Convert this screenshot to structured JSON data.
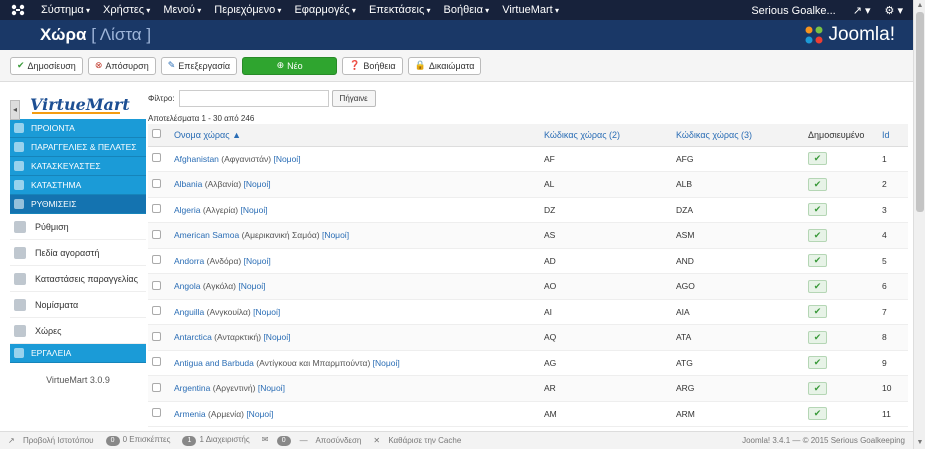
{
  "topnav": {
    "menus": [
      "Σύστημα",
      "Χρήστες",
      "Μενού",
      "Περιεχόμενο",
      "Εφαρμογές",
      "Επεκτάσεις",
      "Βοήθεια",
      "VirtueMart"
    ],
    "user": "Serious Goalke...",
    "user_icon": "external-link-icon",
    "settings_icon": "gear-icon"
  },
  "header": {
    "title": "Χώρα",
    "subtitle": "[ Λίστα ]",
    "brand": "Joomla!"
  },
  "toolbar": {
    "publish": "Δημοσίευση",
    "unpublish": "Απόσυρση",
    "edit": "Επεξεργασία",
    "new": "Νέο",
    "help": "Βοήθεια",
    "permissions": "Δικαιώματα"
  },
  "sidebar": {
    "logo": "VirtueMart",
    "items": [
      {
        "label": "ΠΡΟΙΟΝΤΑ",
        "icon": "products-icon"
      },
      {
        "label": "ΠΑΡΑΓΓΕΛΙΕΣ & ΠΕΛΑΤΕΣ",
        "icon": "orders-icon"
      },
      {
        "label": "ΚΑΤΑΣΚΕΥΑΣΤΕΣ",
        "icon": "wrench-icon"
      },
      {
        "label": "ΚΑΤΑΣΤΗΜΑ",
        "icon": "store-icon"
      },
      {
        "label": "ΡΥΘΜΙΣΕΙΣ",
        "icon": "settings-icon"
      }
    ],
    "subitems": [
      {
        "label": "Ρύθμιση",
        "icon": "config-icon"
      },
      {
        "label": "Πεδία αγοραστή",
        "icon": "fields-icon"
      },
      {
        "label": "Καταστάσεις παραγγελίας",
        "icon": "order-status-icon"
      },
      {
        "label": "Νομίσματα",
        "icon": "currency-icon"
      },
      {
        "label": "Χώρες",
        "icon": "globe-icon"
      }
    ],
    "tools": "ΕΡΓΑΛΕΙΑ",
    "version": "VirtueMart 3.0.9"
  },
  "main": {
    "filter_label": "Φίλτρο:",
    "filter_value": "",
    "go_button": "Πήγαινε",
    "results": "Αποτελέσματα 1 - 30 από 246",
    "columns": [
      "Ονομα χώρας ▲",
      "Κώδικας χώρας (2)",
      "Κώδικας χώρας (3)",
      "Δημοσιευμένο",
      "Id"
    ],
    "rows": [
      {
        "name": "Afghanistan",
        "local": "(Αφγανιστάν)",
        "states": "[Νομοί]",
        "code2": "AF",
        "code3": "AFG",
        "id": "1"
      },
      {
        "name": "Albania",
        "local": "(Αλβανία)",
        "states": "[Νομοί]",
        "code2": "AL",
        "code3": "ALB",
        "id": "2"
      },
      {
        "name": "Algeria",
        "local": "(Αλγερία)",
        "states": "[Νομοί]",
        "code2": "DZ",
        "code3": "DZA",
        "id": "3"
      },
      {
        "name": "American Samoa",
        "local": "(Αμερικανική Σαμόα)",
        "states": "[Νομοί]",
        "code2": "AS",
        "code3": "ASM",
        "id": "4"
      },
      {
        "name": "Andorra",
        "local": "(Ανδόρα)",
        "states": "[Νομοί]",
        "code2": "AD",
        "code3": "AND",
        "id": "5"
      },
      {
        "name": "Angola",
        "local": "(Αγκόλα)",
        "states": "[Νομοί]",
        "code2": "AO",
        "code3": "AGO",
        "id": "6"
      },
      {
        "name": "Anguilla",
        "local": "(Ανγκουίλα)",
        "states": "[Νομοί]",
        "code2": "AI",
        "code3": "AIA",
        "id": "7"
      },
      {
        "name": "Antarctica",
        "local": "(Ανταρκτική)",
        "states": "[Νομοί]",
        "code2": "AQ",
        "code3": "ATA",
        "id": "8"
      },
      {
        "name": "Antigua and Barbuda",
        "local": "(Αντίγκουα και Μπαρμπούντα)",
        "states": "[Νομοί]",
        "code2": "AG",
        "code3": "ATG",
        "id": "9"
      },
      {
        "name": "Argentina",
        "local": "(Αργεντινή)",
        "states": "[Νομοί]",
        "code2": "AR",
        "code3": "ARG",
        "id": "10"
      },
      {
        "name": "Armenia",
        "local": "(Αρμενία)",
        "states": "[Νομοί]",
        "code2": "AM",
        "code3": "ARM",
        "id": "11"
      }
    ]
  },
  "footer": {
    "view_site": "Προβολή Ιστοτόπου",
    "visitors_count": "0",
    "visitors": "0 Επισκέπτες",
    "admins_count": "1",
    "admins": "1 Διαχειριστής",
    "messages_count": "0",
    "logout": "Αποσύνδεση",
    "clear_cache": "Καθάρισε την Cache",
    "copyright": "Joomla! 3.4.1 — © 2015 Serious Goalkeeping"
  },
  "colors": {
    "topnav": "#17223b",
    "header": "#1a3867",
    "sidebar_accent": "#1b9bd7",
    "new_button": "#2fa52f",
    "link": "#2a6db5"
  }
}
